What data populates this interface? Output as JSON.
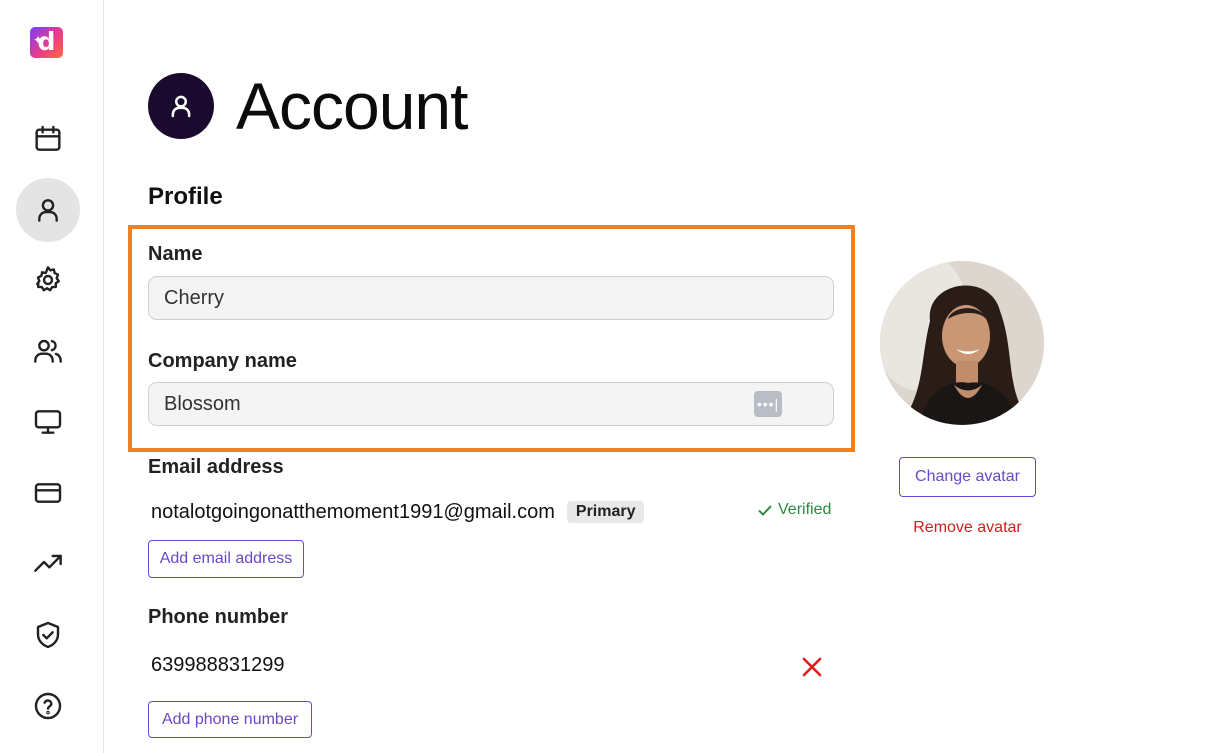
{
  "app": {
    "logo_letter": "d",
    "logo_spark": "✦"
  },
  "sidebar": {
    "items": [
      {
        "name": "calendar",
        "active": false
      },
      {
        "name": "account",
        "active": true
      },
      {
        "name": "settings",
        "active": false
      },
      {
        "name": "team",
        "active": false
      },
      {
        "name": "display",
        "active": false
      },
      {
        "name": "billing",
        "active": false
      },
      {
        "name": "analytics",
        "active": false
      },
      {
        "name": "security",
        "active": false
      },
      {
        "name": "help",
        "active": false
      }
    ]
  },
  "header": {
    "title": "Account"
  },
  "profile": {
    "section_title": "Profile",
    "name_label": "Name",
    "name_value": "Cherry",
    "company_label": "Company name",
    "company_value": "Blossom",
    "email_label": "Email address",
    "email_value": "notalotgoingonatthemoment1991@gmail.com",
    "email_badge": "Primary",
    "email_status": "Verified",
    "add_email_label": "Add email address",
    "phone_label": "Phone number",
    "phone_value": "639988831299",
    "add_phone_label": "Add phone number"
  },
  "avatar": {
    "change_label": "Change avatar",
    "remove_label": "Remove avatar"
  },
  "colors": {
    "highlight": "#f28020",
    "accent": "#6a48c9",
    "danger": "#d0201c",
    "success": "#2b8a3e"
  }
}
